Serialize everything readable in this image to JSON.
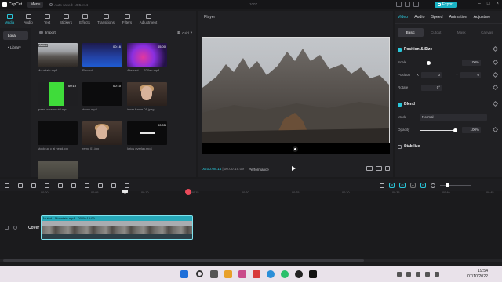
{
  "app": {
    "name": "CapCut",
    "menu_label": "Menu",
    "autosave": "Auto saved: 19:54:14",
    "doc_title": "1007",
    "export_label": "Export"
  },
  "toolbar": [
    {
      "label": "Media",
      "icon": "media-icon",
      "active": true
    },
    {
      "label": "Audio",
      "icon": "audio-icon"
    },
    {
      "label": "Text",
      "icon": "text-icon"
    },
    {
      "label": "Stickers",
      "icon": "stickers-icon"
    },
    {
      "label": "Effects",
      "icon": "effects-icon"
    },
    {
      "label": "Transitions",
      "icon": "transitions-icon"
    },
    {
      "label": "Filters",
      "icon": "filters-icon"
    },
    {
      "label": "Adjustment",
      "icon": "adjustment-icon"
    }
  ],
  "media_nav": {
    "local": "Local",
    "library": "• Library"
  },
  "media": {
    "import_label": "Import",
    "grid_label": "Grid",
    "items": [
      {
        "caption": "Mountain.mp4",
        "duration": "",
        "added": "Added",
        "kind": "mountain"
      },
      {
        "caption": "Recordi...",
        "duration": "00:16",
        "added": "",
        "kind": "audio"
      },
      {
        "caption": "Abstract - ...520ec.mp4",
        "duration": "05:00",
        "added": "",
        "kind": "abstract"
      },
      {
        "caption": "green screen vid.mp4",
        "duration": "00:10",
        "added": "",
        "kind": "green"
      },
      {
        "caption": "demo.mp4",
        "duration": "00:10",
        "added": "",
        "kind": "dark"
      },
      {
        "caption": "inner frame 01.jpeg",
        "duration": "",
        "added": "",
        "kind": "face"
      },
      {
        "caption": "stock up c ai head.jpg",
        "duration": "",
        "added": "",
        "kind": "dark"
      },
      {
        "caption": "remy 01.jpg",
        "duration": "",
        "added": "",
        "kind": "face"
      },
      {
        "caption": "lyrics overlay.mp4",
        "duration": "00:05",
        "added": "",
        "kind": "lyric"
      },
      {
        "caption": "",
        "duration": "",
        "added": "",
        "kind": "video2"
      }
    ]
  },
  "player": {
    "title": "Player",
    "current_time": "00:00:08.14",
    "total_time": "00:00:15:09",
    "performance": "Performance"
  },
  "inspector": {
    "tabs": [
      "Video",
      "Audio",
      "Speed",
      "Animation",
      "Adjustme"
    ],
    "sub_tabs": [
      "Basic",
      "Cutout",
      "Mask",
      "Canvas"
    ],
    "position_size": "Position & Size",
    "scale_label": "Scale",
    "scale_value": "100%",
    "scale_level": 0.25,
    "position_label": "Position",
    "pos_x_label": "X",
    "pos_x": "0",
    "pos_y_label": "Y",
    "pos_y": "0",
    "rotate_label": "Rotate",
    "rotate_value": "0°",
    "blend": "Blend",
    "mode_label": "Mode",
    "mode_value": "Normal",
    "opacity_label": "Opacity",
    "opacity_value": "100%",
    "opacity_level": 1.0,
    "stabilize": "Stabilize"
  },
  "timeline": {
    "ruler": [
      "00:00",
      "00:05",
      "00:10",
      "00:15",
      "00:20",
      "00:25",
      "00:30",
      "00:35",
      "00:40",
      "00:45"
    ],
    "cover_label": "Cover",
    "clip_muted": "Muted",
    "clip_name": "Mountain.mp4",
    "clip_duration": "00:00:15:09"
  },
  "taskbar": {
    "time": "19:54",
    "date": "07/10/2022"
  },
  "colors": {
    "accent": "#2ac7da",
    "export": "#1ab3c4",
    "clip": "#1a6f7a",
    "marker": "#ea4a5a"
  }
}
